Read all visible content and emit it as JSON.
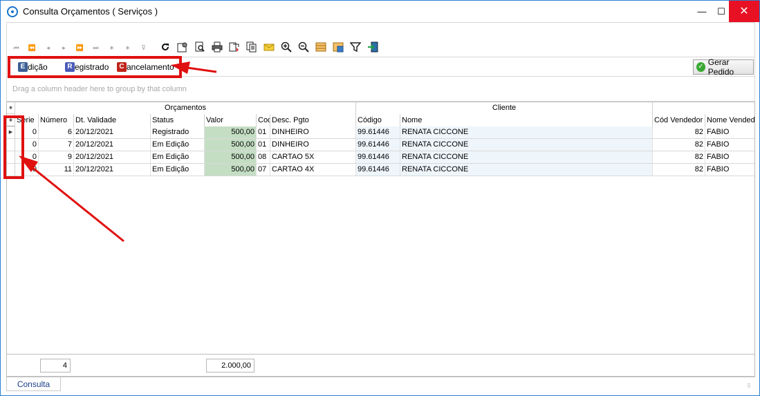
{
  "window": {
    "title": "Consulta Orçamentos ( Serviços )",
    "min_glyph": "—",
    "max_glyph": "☐",
    "close_glyph": "✕"
  },
  "toolbar": {
    "nav_icons": [
      "first-icon",
      "prev-page-icon",
      "prev-icon",
      "next-icon",
      "next-page-icon",
      "last-icon",
      "insert-icon",
      "delete-icon",
      "filter-down-icon"
    ],
    "nav_glyphs": [
      "⏮",
      "⏪",
      "◂",
      "▸",
      "⏩",
      "⏭",
      "∗",
      "∗",
      "⊽"
    ],
    "tool_icons": [
      "refresh-icon",
      "settings-icon",
      "preview-icon",
      "print-icon",
      "export-icon",
      "copy-icon",
      "email-icon",
      "zoom-in-icon",
      "zoom-out-icon",
      "layout-icon",
      "grid-options-icon",
      "filter-icon",
      "exit-icon"
    ]
  },
  "legend": {
    "items": [
      {
        "badge": "E",
        "label": "dição"
      },
      {
        "badge": "R",
        "label": "egistrado"
      },
      {
        "badge": "C",
        "label": "ancelamento"
      }
    ],
    "gerar_label": "Gerar Pedido"
  },
  "group_panel": {
    "hint": "Drag a column header here to group by that column"
  },
  "grid": {
    "bands": {
      "orcamentos": "Orçamentos",
      "cliente": "Cliente",
      "empty": ""
    },
    "columns": {
      "serie": "Serie",
      "numero": "Número",
      "validade": "Dt. Validade",
      "status": "Status",
      "valor": "Valor",
      "cod": "Cod",
      "desc": "Desc. Pgto",
      "codigo": "Código",
      "nome": "Nome",
      "cod_vendedor": "Cód Vendedor",
      "nome_vendedor": "Nome Vendedor"
    },
    "rows": [
      {
        "serie": "0",
        "numero": "6",
        "validade": "20/12/2021",
        "status": "Registrado",
        "valor": "500,00",
        "cod": "01",
        "desc": "DINHEIRO",
        "codigo": "99.61446",
        "nome": "RENATA CICCONE",
        "cod_vendedor": "82",
        "nome_vendedor": "FABIO"
      },
      {
        "serie": "0",
        "numero": "7",
        "validade": "20/12/2021",
        "status": "Em Edição",
        "valor": "500,00",
        "cod": "01",
        "desc": "DINHEIRO",
        "codigo": "99.61446",
        "nome": "RENATA CICCONE",
        "cod_vendedor": "82",
        "nome_vendedor": "FABIO"
      },
      {
        "serie": "0",
        "numero": "9",
        "validade": "20/12/2021",
        "status": "Em Edição",
        "valor": "500,00",
        "cod": "08",
        "desc": "CARTAO 5X",
        "codigo": "99.61446",
        "nome": "RENATA CICCONE",
        "cod_vendedor": "82",
        "nome_vendedor": "FABIO"
      },
      {
        "serie": "0",
        "numero": "11",
        "validade": "20/12/2021",
        "status": "Em Edição",
        "valor": "500,00",
        "cod": "07",
        "desc": "CARTAO 4X",
        "codigo": "99.61446",
        "nome": "RENATA CICCONE",
        "cod_vendedor": "82",
        "nome_vendedor": "FABIO"
      }
    ]
  },
  "footer": {
    "count": "4",
    "total": "2.000,00"
  },
  "tabs": {
    "consulta": "Consulta"
  },
  "annotation_color": "#e01010"
}
